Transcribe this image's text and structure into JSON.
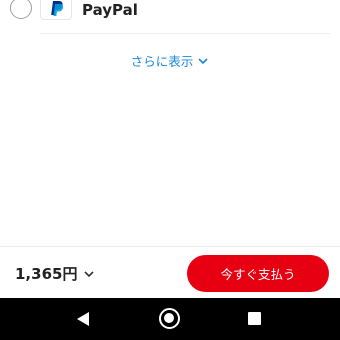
{
  "payment_options": [
    {
      "label": "PayPal",
      "icon": "paypal-logo-icon",
      "selected": false
    }
  ],
  "show_more": {
    "label": "さらに表示",
    "icon": "chevron-down-icon"
  },
  "footer": {
    "total": "1,365円",
    "total_icon": "chevron-down-icon",
    "pay_button": "今すぐ支払う"
  },
  "colors": {
    "accent_red": "#e60012",
    "link_blue": "#1a89d8",
    "paypal_dark": "#003087",
    "paypal_light": "#009cde"
  },
  "nav": {
    "back_icon": "back-triangle-icon",
    "home_icon": "home-circle-icon",
    "recent_icon": "recent-apps-icon"
  }
}
